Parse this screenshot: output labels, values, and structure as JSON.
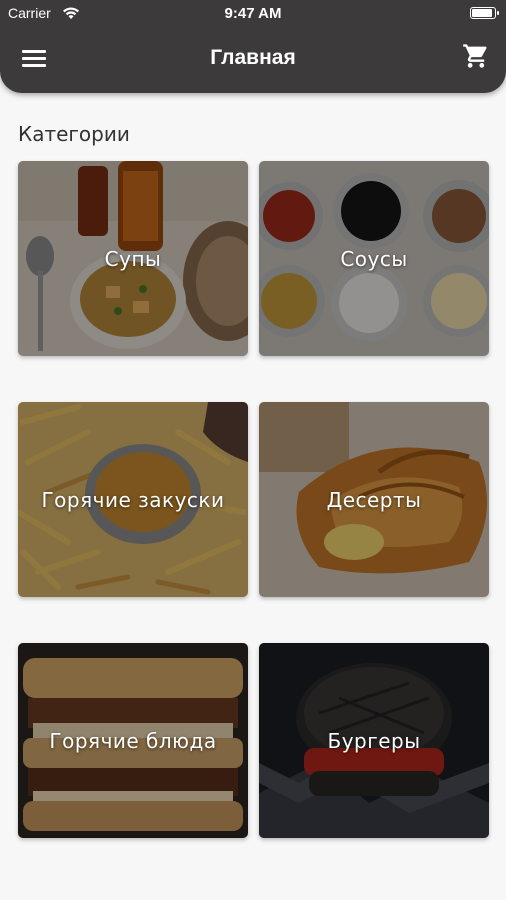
{
  "status_bar": {
    "carrier": "Carrier",
    "time": "9:47 AM",
    "battery_level": 1.0
  },
  "app_bar": {
    "title": "Главная",
    "menu_icon": "hamburger-menu-icon",
    "cart_icon": "shopping-cart-icon",
    "background": "#3d3a3b"
  },
  "categories": {
    "heading": "Категории",
    "items": [
      {
        "label": "Супы"
      },
      {
        "label": "Соусы"
      },
      {
        "label": "Горячие закуски"
      },
      {
        "label": "Десерты"
      },
      {
        "label": "Горячие блюда"
      },
      {
        "label": "Бургеры"
      }
    ]
  }
}
